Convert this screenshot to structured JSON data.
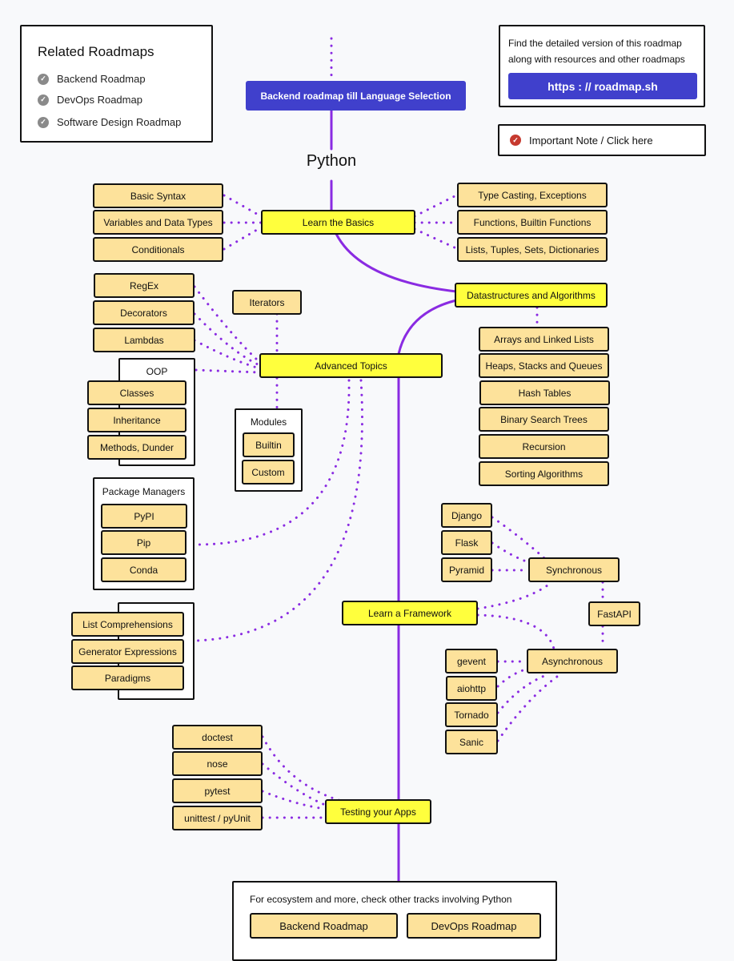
{
  "title": "Python",
  "colors": {
    "accent": "#4040cc",
    "line": "#8a2be2",
    "main_node": "#ffff3d",
    "topic_node": "#fde29b"
  },
  "related": {
    "heading": "Related Roadmaps",
    "items": [
      {
        "label": "Backend Roadmap",
        "icon": "check-circle-icon"
      },
      {
        "label": "DevOps Roadmap",
        "icon": "check-circle-icon"
      },
      {
        "label": "Software Design Roadmap",
        "icon": "check-circle-icon"
      }
    ]
  },
  "promo": {
    "text_line1": "Find the detailed version of this roadmap",
    "text_line2": "along with resources and other roadmaps",
    "link_label": "https : // roadmap.sh"
  },
  "note": {
    "label": "Important Note / Click here",
    "icon": "check-circle-icon"
  },
  "start_button": "Backend roadmap till Language Selection",
  "basics": {
    "label": "Learn the Basics",
    "left": [
      "Basic Syntax",
      "Variables and Data Types",
      "Conditionals"
    ],
    "right": [
      "Type Casting, Exceptions",
      "Functions, Builtin Functions",
      "Lists, Tuples, Sets, Dictionaries"
    ]
  },
  "dsa": {
    "label": "Datastructures and Algorithms",
    "items": [
      "Arrays and Linked Lists",
      "Heaps, Stacks and Queues",
      "Hash Tables",
      "Binary Search Trees",
      "Recursion",
      "Sorting Algorithms"
    ]
  },
  "advanced": {
    "label": "Advanced Topics",
    "left": [
      "RegEx",
      "Decorators",
      "Lambdas"
    ],
    "iterators": "Iterators",
    "oop": {
      "title": "OOP",
      "items": [
        "Classes",
        "Inheritance",
        "Methods, Dunder"
      ]
    },
    "modules": {
      "title": "Modules",
      "items": [
        "Builtin",
        "Custom"
      ]
    },
    "package_managers": {
      "title": "Package Managers",
      "items": [
        "PyPI",
        "Pip",
        "Conda"
      ]
    },
    "misc": [
      "List Comprehensions",
      "Generator Expressions",
      "Paradigms"
    ]
  },
  "framework": {
    "label": "Learn a Framework",
    "sync": {
      "label": "Synchronous",
      "items": [
        "Django",
        "Flask",
        "Pyramid"
      ]
    },
    "fastapi": "FastAPI",
    "async": {
      "label": "Asynchronous",
      "items": [
        "gevent",
        "aiohttp",
        "Tornado",
        "Sanic"
      ]
    }
  },
  "testing": {
    "label": "Testing your Apps",
    "items": [
      "doctest",
      "nose",
      "pytest",
      "unittest / pyUnit"
    ]
  },
  "footer": {
    "text": "For ecosystem and more, check other tracks involving Python",
    "buttons": [
      "Backend Roadmap",
      "DevOps Roadmap"
    ]
  }
}
